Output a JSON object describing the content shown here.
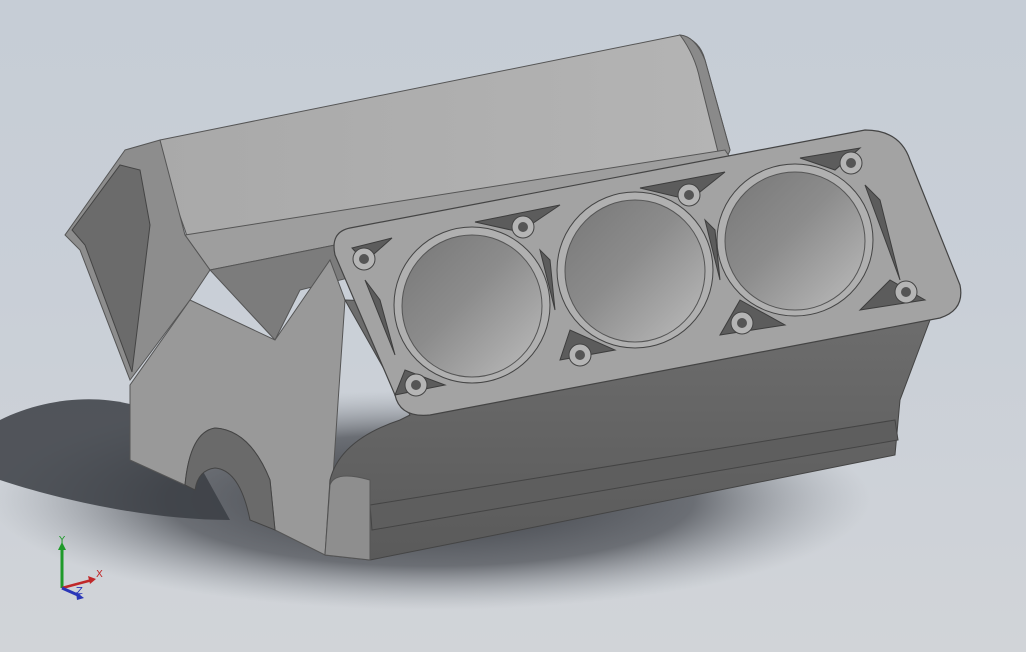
{
  "viewport": {
    "model": "engine-block-v6",
    "background_top": "#c6cdd6",
    "background_bottom": "#d1d4d8"
  },
  "triad": {
    "x_label": "X",
    "y_label": "Y",
    "z_label": "Z",
    "x_color": "#c0282a",
    "y_color": "#1f9a2a",
    "z_color": "#2a36b8"
  }
}
